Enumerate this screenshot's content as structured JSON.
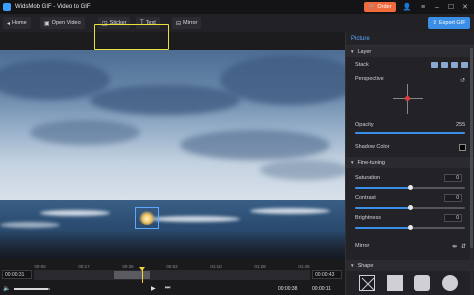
{
  "app": {
    "title": "WidsMob GIF - Video to GIF",
    "order_label": "Order"
  },
  "toolbar": {
    "home_label": "Home",
    "open_video_label": "Open Video",
    "sticker_label": "Sticker",
    "text_label": "Text",
    "mirror_label": "Mirror",
    "export_label": "Export GIF"
  },
  "panel": {
    "tab_label": "Picture",
    "layer_section": "Layer",
    "stack_label": "Stack",
    "perspective_label": "Perspective",
    "opacity_label": "Opacity",
    "opacity_value": "255",
    "shadow_color_label": "Shadow Color",
    "fine_tuning_section": "Fine-tuning",
    "saturation_label": "Saturation",
    "saturation_value": "0",
    "contrast_label": "Contrast",
    "contrast_value": "0",
    "brightness_label": "Brightness",
    "brightness_value": "0",
    "mirror_label": "Mirror",
    "shape_section": "Shape"
  },
  "timeline": {
    "start_time": "00:00:31",
    "end_time": "00:00:43",
    "current_time": "00:00:38",
    "total_time": "00:00:11",
    "ruler_ticks": [
      "00:00",
      "00:17",
      "00:35",
      "00:52",
      "01:10",
      "01:28",
      "01:45"
    ],
    "playhead_fraction": 0.39,
    "volume_fraction": 0.95
  },
  "colors": {
    "accent": "#3a8ee6",
    "order": "#f06a3c",
    "highlight": "#e6e23a",
    "playhead": "#f0d23a"
  }
}
